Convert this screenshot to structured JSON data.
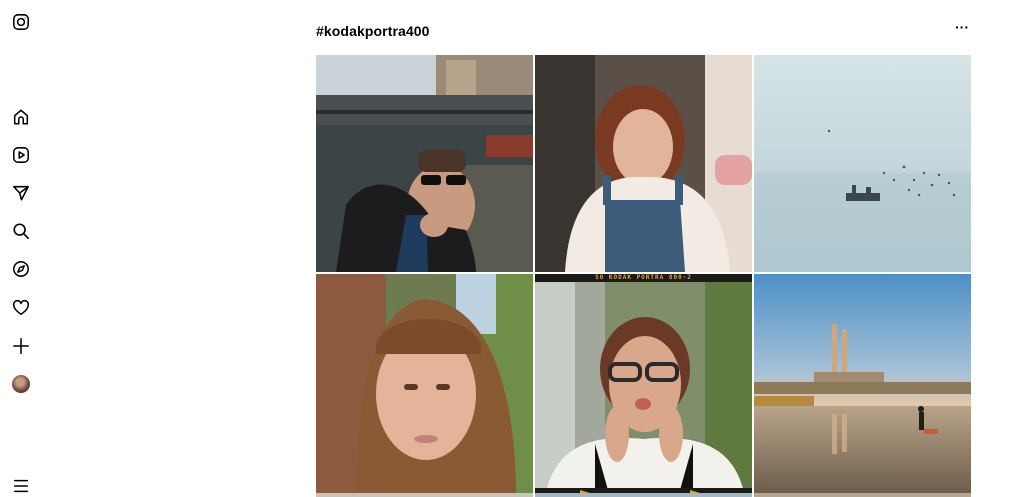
{
  "sidebar": {
    "items": [
      {
        "name": "instagram-logo-icon"
      },
      {
        "name": "home-icon"
      },
      {
        "name": "reels-icon"
      },
      {
        "name": "messages-icon"
      },
      {
        "name": "search-icon"
      },
      {
        "name": "explore-icon"
      },
      {
        "name": "notifications-heart-icon"
      },
      {
        "name": "create-plus-icon"
      },
      {
        "name": "profile-avatar"
      },
      {
        "name": "more-menu-icon"
      }
    ]
  },
  "header": {
    "title": "#kodakportra400",
    "more_label": "···"
  },
  "posts": [
    {
      "subject": "man with sunglasses by canal"
    },
    {
      "subject": "woman in overalls smiling"
    },
    {
      "subject": "fishing boat with seagulls"
    },
    {
      "subject": "woman with bangs portrait"
    },
    {
      "subject": "woman with glasses blowing kiss",
      "film_label": "50      KODAK  PORTRA 800-2"
    },
    {
      "subject": "beach at sunset with chimneys"
    }
  ],
  "colors": {
    "background": "#ffffff",
    "icon": "#000000"
  }
}
